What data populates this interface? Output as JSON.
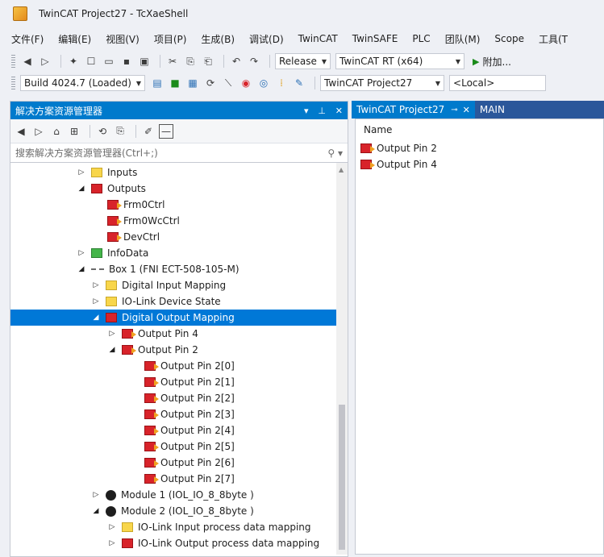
{
  "window": {
    "title": "TwinCAT Project27 - TcXaeShell"
  },
  "menu": [
    "文件(F)",
    "编辑(E)",
    "视图(V)",
    "项目(P)",
    "生成(B)",
    "调试(D)",
    "TwinCAT",
    "TwinSAFE",
    "PLC",
    "团队(M)",
    "Scope",
    "工具(T"
  ],
  "toolbar1": {
    "config": "Release",
    "platform": "TwinCAT RT (x64)",
    "attach": "附加..."
  },
  "toolbar2": {
    "build": "Build 4024.7 (Loaded)",
    "project": "TwinCAT Project27",
    "target": "<Local>"
  },
  "solution_explorer": {
    "title": "解决方案资源管理器",
    "search_placeholder": "搜索解决方案资源管理器(Ctrl+;)",
    "items": [
      {
        "label": "Inputs",
        "expander": "▷",
        "icon": "yellow"
      },
      {
        "label": "Outputs",
        "expander": "◢",
        "icon": "red"
      },
      {
        "label": "Frm0Ctrl",
        "expander": "",
        "icon": "red-out"
      },
      {
        "label": "Frm0WcCtrl",
        "expander": "",
        "icon": "red-out"
      },
      {
        "label": "DevCtrl",
        "expander": "",
        "icon": "red-out"
      },
      {
        "label": "InfoData",
        "expander": "▷",
        "icon": "green"
      },
      {
        "label": "Box 1 (FNI ECT-508-105-M)",
        "expander": "◢",
        "icon": "box"
      },
      {
        "label": "Digital Input Mapping",
        "expander": "▷",
        "icon": "yellow"
      },
      {
        "label": "IO-Link Device State",
        "expander": "▷",
        "icon": "yellow"
      },
      {
        "label": "Digital Output Mapping",
        "expander": "◢",
        "icon": "red",
        "selected": true
      },
      {
        "label": "Output Pin 4",
        "expander": "▷",
        "icon": "red-out"
      },
      {
        "label": "Output Pin 2",
        "expander": "◢",
        "icon": "red-out"
      },
      {
        "label": "Output Pin 2[0]",
        "expander": "",
        "icon": "red-out"
      },
      {
        "label": "Output Pin 2[1]",
        "expander": "",
        "icon": "red-out"
      },
      {
        "label": "Output Pin 2[2]",
        "expander": "",
        "icon": "red-out"
      },
      {
        "label": "Output Pin 2[3]",
        "expander": "",
        "icon": "red-out"
      },
      {
        "label": "Output Pin 2[4]",
        "expander": "",
        "icon": "red-out"
      },
      {
        "label": "Output Pin 2[5]",
        "expander": "",
        "icon": "red-out"
      },
      {
        "label": "Output Pin 2[6]",
        "expander": "",
        "icon": "red-out"
      },
      {
        "label": "Output Pin 2[7]",
        "expander": "",
        "icon": "red-out"
      },
      {
        "label": "Module 1 (IOL_IO_8_8byte )",
        "expander": "▷",
        "icon": "module"
      },
      {
        "label": "Module 2 (IOL_IO_8_8byte )",
        "expander": "◢",
        "icon": "module"
      },
      {
        "label": "IO-Link Input process data mapping",
        "expander": "▷",
        "icon": "yellow"
      },
      {
        "label": "IO-Link Output process data mapping",
        "expander": "▷",
        "icon": "red"
      }
    ]
  },
  "document": {
    "tabs": [
      {
        "label": "TwinCAT Project27",
        "active": true
      },
      {
        "label": "MAIN",
        "active": false
      }
    ],
    "column_header": "Name",
    "rows": [
      "Output Pin 2",
      "Output Pin 4"
    ]
  },
  "colors": {
    "accent": "#007acc",
    "selection": "#0078d7",
    "tab_bar": "#2b579a"
  }
}
